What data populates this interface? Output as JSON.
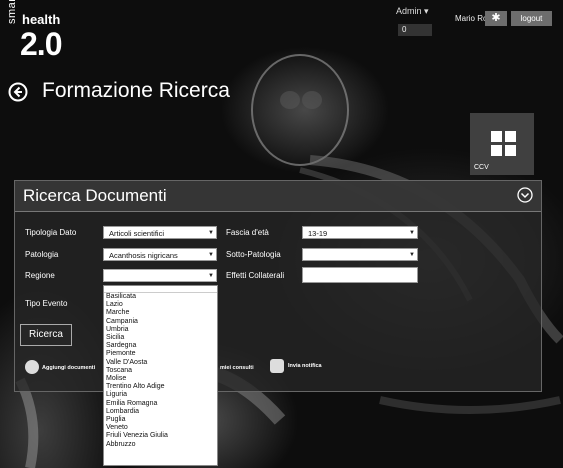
{
  "logo": {
    "smart": "smart",
    "health": "health",
    "version": "2.0"
  },
  "topbar": {
    "admin_label": "Admin ▾",
    "admin_count": "0",
    "user_name": "Mario Rossi",
    "star_glyph": "✱",
    "logout_label": "logout"
  },
  "page": {
    "title": "Formazione Ricerca"
  },
  "tile": {
    "label": "CCV"
  },
  "panel": {
    "title": "Ricerca Documenti",
    "fields": {
      "tipologia_dato_label": "Tipologia Dato",
      "tipologia_dato_value": "Articoli scientifici",
      "fascia_eta_label": "Fascia d'età",
      "fascia_eta_value": "13-19",
      "patologia_label": "Patologia",
      "patologia_value": "Acanthosis nigricans",
      "sotto_patologia_label": "Sotto-Patologia",
      "sotto_patologia_value": "",
      "regione_label": "Regione",
      "regione_value": "",
      "effetti_collaterali_label": "Effetti Collaterali",
      "effetti_collaterali_value": "",
      "tipo_evento_label": "Tipo Evento"
    },
    "search_button": "Ricerca",
    "actions": {
      "add_document": "Aggiungi documenti",
      "my_consults": "miei consulti",
      "send_notification": "Invia notifica"
    }
  },
  "regione_options": [
    "Basilicata",
    "Lazio",
    "Marche",
    "Campania",
    "Umbria",
    "Sicilia",
    "Sardegna",
    "Piemonte",
    "Valle D'Aosta",
    "Toscana",
    "Molise",
    "Trentino Alto Adige",
    "Liguria",
    "Emilia Romagna",
    "Lombardia",
    "Puglia",
    "Veneto",
    "Friuli Venezia Giulia",
    "Abbruzzo"
  ],
  "colors": {
    "panel_bg": "#262626",
    "button_gray": "#6d6d6d"
  }
}
